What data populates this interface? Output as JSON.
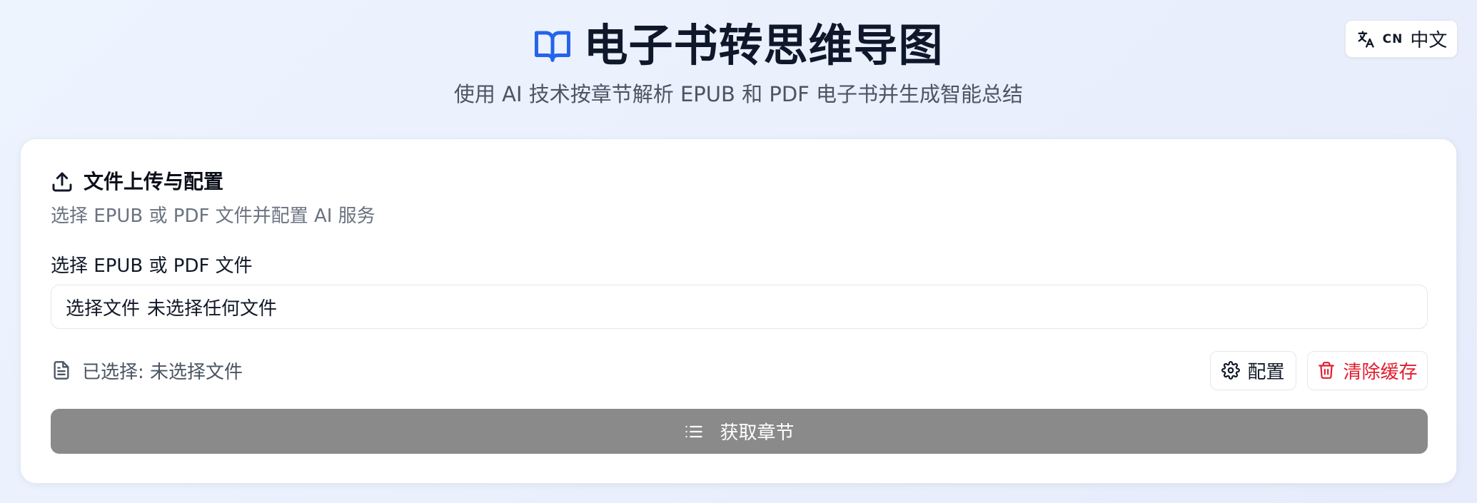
{
  "header": {
    "title": "电子书转思维导图",
    "title_icon": "book-open-icon",
    "subtitle": "使用 AI 技术按章节解析 EPUB 和 PDF 电子书并生成智能总结",
    "language_switch": {
      "icon": "translate-icon",
      "code": "CN",
      "label": "中文"
    }
  },
  "upload_card": {
    "icon": "upload-icon",
    "title": "文件上传与配置",
    "description": "选择 EPUB 或 PDF 文件并配置 AI 服务",
    "file_field": {
      "label": "选择 EPUB 或 PDF 文件",
      "button_text": "选择文件",
      "value_text": "未选择任何文件"
    },
    "status": {
      "icon": "file-text-icon",
      "text": "已选择: 未选择文件"
    },
    "config_button": {
      "icon": "gear-icon",
      "label": "配置"
    },
    "clear_cache_button": {
      "icon": "trash-icon",
      "label": "清除缓存"
    },
    "get_chapters_button": {
      "icon": "list-icon",
      "label": "获取章节"
    }
  },
  "colors": {
    "accent_blue": "#2563eb",
    "danger_red": "#e11d2e",
    "disabled_button": "#8a8a8a",
    "page_background": "#eaf0fc"
  }
}
